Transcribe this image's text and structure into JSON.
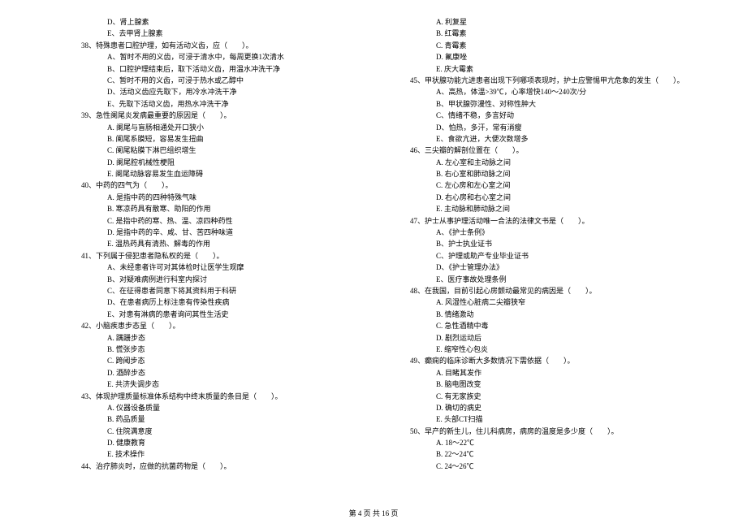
{
  "leftColumn": [
    {
      "cls": "option-left",
      "text": "D、肾上腺素"
    },
    {
      "cls": "option-left",
      "text": "E、去甲肾上腺素"
    },
    {
      "cls": "question",
      "text": "38、特殊患者口腔护理，如有活动义齿，应（　　）。"
    },
    {
      "cls": "option-left",
      "text": "A、暂时不用的义齿，可浸于清水中，每周更换1次清水"
    },
    {
      "cls": "option-left",
      "text": "B、口腔护理结束后，取下活动义齿，用温水冲洗干净"
    },
    {
      "cls": "option-left",
      "text": "C、暂时不用的义齿，可浸于热水或乙醇中"
    },
    {
      "cls": "option-left",
      "text": "D、活动义齿应先取下，用冷水冲洗干净"
    },
    {
      "cls": "option-left",
      "text": "E、先取下活动义齿，用热水冲洗干净"
    },
    {
      "cls": "question",
      "text": "39、急性阑尾炎发病最重要的原因是（　　）。"
    },
    {
      "cls": "option-left",
      "text": "A. 阑尾与盲肠相通处开口狭小"
    },
    {
      "cls": "option-left",
      "text": "B. 阑尾系膜短，容易发生扭曲"
    },
    {
      "cls": "option-left",
      "text": "C. 阑尾粘膜下淋巴组织增生"
    },
    {
      "cls": "option-left",
      "text": "D. 阑尾腔机械性梗阻"
    },
    {
      "cls": "option-left",
      "text": "E. 阑尾动脉容易发生血运障碍"
    },
    {
      "cls": "question",
      "text": "40、中药的四气为（　　）。"
    },
    {
      "cls": "option-left",
      "text": "A. 是指中药的四种特殊气味"
    },
    {
      "cls": "option-left",
      "text": "B. 寒凉药具有散寒、助阳的作用"
    },
    {
      "cls": "option-left",
      "text": "C. 是指中药的寒、热、温、凉四种药性"
    },
    {
      "cls": "option-left",
      "text": "D. 是指中药的辛、咸、甘、苦四种味道"
    },
    {
      "cls": "option-left",
      "text": "E. 温热药具有清热、解毒的作用"
    },
    {
      "cls": "question",
      "text": "41、下列属于侵犯患者隐私权的是（　　）。"
    },
    {
      "cls": "option-left",
      "text": "A、未经患者许可对其体检时让医学生观摩"
    },
    {
      "cls": "option-left",
      "text": "B、对疑难病例进行科室内探讨"
    },
    {
      "cls": "option-left",
      "text": "C、在征得患者同意下将其资料用于科研"
    },
    {
      "cls": "option-left",
      "text": "D、在患者病历上标注患有传染性疾病"
    },
    {
      "cls": "option-left",
      "text": "E、对患有淋病的患者询问其性生活史"
    },
    {
      "cls": "question",
      "text": "42、小脑疾患步态呈（　　）。"
    },
    {
      "cls": "option-left",
      "text": "A. 蹒跚步态"
    },
    {
      "cls": "option-left",
      "text": "B. 慌张步态"
    },
    {
      "cls": "option-left",
      "text": "C. 跨阈步态"
    },
    {
      "cls": "option-left",
      "text": "D. 酒醉步态"
    },
    {
      "cls": "option-left",
      "text": "E. 共济失调步态"
    },
    {
      "cls": "question",
      "text": "43、体现护理质量标准体系结构中终末质量的条目是（　　）。"
    },
    {
      "cls": "option-left",
      "text": "A. 仪器设备质量"
    },
    {
      "cls": "option-left",
      "text": "B. 药品质量"
    },
    {
      "cls": "option-left",
      "text": "C. 住院满意度"
    },
    {
      "cls": "option-left",
      "text": "D. 健康教育"
    },
    {
      "cls": "option-left",
      "text": "E. 技术操作"
    },
    {
      "cls": "question",
      "text": "44、治疗肺炎时，应做的抗菌药物是（　　）。"
    }
  ],
  "rightColumn": [
    {
      "cls": "option-left",
      "text": "A. 利复星"
    },
    {
      "cls": "option-left",
      "text": "B. 红霉素"
    },
    {
      "cls": "option-left",
      "text": "C. 青霉素"
    },
    {
      "cls": "option-left",
      "text": "D. 氟康唑"
    },
    {
      "cls": "option-left",
      "text": "E. 庆大霉素"
    },
    {
      "cls": "question",
      "text": "45、甲状腺功能亢进患者出现下列哪项表现时，护士应警惕甲亢危象的发生（　　）。"
    },
    {
      "cls": "option-left",
      "text": "A、高热，体温>39℃，心率增快140～240次/分"
    },
    {
      "cls": "option-left",
      "text": "B、甲状腺弥漫性、对称性肿大"
    },
    {
      "cls": "option-left",
      "text": "C、情绪不稳，多言好动"
    },
    {
      "cls": "option-left",
      "text": "D、怕热，多汗，常有消瘦"
    },
    {
      "cls": "option-left",
      "text": "E、食欲亢进，大便次数增多"
    },
    {
      "cls": "question",
      "text": "46、三尖瓣的解剖位置在（　　）。"
    },
    {
      "cls": "option-left",
      "text": "A. 左心室和主动脉之间"
    },
    {
      "cls": "option-left",
      "text": "B. 右心室和肺动脉之间"
    },
    {
      "cls": "option-left",
      "text": "C. 左心房和左心室之间"
    },
    {
      "cls": "option-left",
      "text": "D. 右心房和右心室之间"
    },
    {
      "cls": "option-left",
      "text": "E. 主动脉和肺动脉之间"
    },
    {
      "cls": "question",
      "text": "47、护士从事护理活动唯一合法的法律文书是（　　）。"
    },
    {
      "cls": "option-left",
      "text": "A、《护士条例》"
    },
    {
      "cls": "option-left",
      "text": "B、护士执业证书"
    },
    {
      "cls": "option-left",
      "text": "C、护理或助产专业毕业证书"
    },
    {
      "cls": "option-left",
      "text": "D、《护士管理办法》"
    },
    {
      "cls": "option-left",
      "text": "E、医疗事故处理条例"
    },
    {
      "cls": "question",
      "text": "48、在我国，目前引起心房颤动最常见的病因是（　　）。"
    },
    {
      "cls": "option-left",
      "text": "A. 风湿性心脏病二尖瓣狭窄"
    },
    {
      "cls": "option-left",
      "text": "B. 情绪激动"
    },
    {
      "cls": "option-left",
      "text": "C. 急性酒精中毒"
    },
    {
      "cls": "option-left",
      "text": "D. 剧烈运动后"
    },
    {
      "cls": "option-left",
      "text": "E. 缩窄性心包炎"
    },
    {
      "cls": "question",
      "text": "49、癫痫的临床诊断大多数情况下需依据（　　）。"
    },
    {
      "cls": "option-left",
      "text": "A. 目睹其发作"
    },
    {
      "cls": "option-left",
      "text": "B. 脑电图改变"
    },
    {
      "cls": "option-left",
      "text": "C. 有无家族史"
    },
    {
      "cls": "option-left",
      "text": "D. 确切的病史"
    },
    {
      "cls": "option-left",
      "text": "E. 头部CT扫描"
    },
    {
      "cls": "question",
      "text": "50、早产的新生儿，住儿科病房，病房的温度是多少度（　　）。"
    },
    {
      "cls": "option-left",
      "text": "A. 18～22℃"
    },
    {
      "cls": "option-left",
      "text": "B. 22～24℃"
    },
    {
      "cls": "option-left",
      "text": "C. 24～26℃"
    }
  ],
  "footer": "第 4 页 共 16 页"
}
